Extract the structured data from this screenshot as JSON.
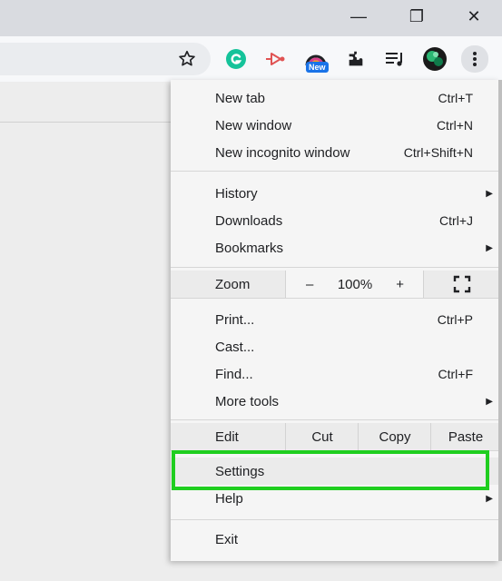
{
  "window": {
    "minimize": "—",
    "maximize": "❐",
    "close": "✕"
  },
  "toolbar": {
    "icons": [
      "star-icon",
      "grammarly-icon",
      "extension-icon",
      "new-extension-icon",
      "puzzle-icon",
      "reading-list-icon",
      "avatar",
      "more-icon"
    ],
    "new_badge": "New"
  },
  "menu": {
    "new_tab": {
      "label": "New tab",
      "shortcut": "Ctrl+T"
    },
    "new_window": {
      "label": "New window",
      "shortcut": "Ctrl+N"
    },
    "new_incognito": {
      "label": "New incognito window",
      "shortcut": "Ctrl+Shift+N"
    },
    "history": {
      "label": "History"
    },
    "downloads": {
      "label": "Downloads",
      "shortcut": "Ctrl+J"
    },
    "bookmarks": {
      "label": "Bookmarks"
    },
    "zoom": {
      "label": "Zoom",
      "minus": "–",
      "value": "100%",
      "plus": "+"
    },
    "print": {
      "label": "Print...",
      "shortcut": "Ctrl+P"
    },
    "cast": {
      "label": "Cast..."
    },
    "find": {
      "label": "Find...",
      "shortcut": "Ctrl+F"
    },
    "more_tools": {
      "label": "More tools"
    },
    "edit": {
      "label": "Edit",
      "cut": "Cut",
      "copy": "Copy",
      "paste": "Paste"
    },
    "settings": {
      "label": "Settings"
    },
    "help": {
      "label": "Help"
    },
    "exit": {
      "label": "Exit"
    }
  },
  "colors": {
    "highlight": "#1fce1f",
    "accent": "#1a73e8"
  }
}
